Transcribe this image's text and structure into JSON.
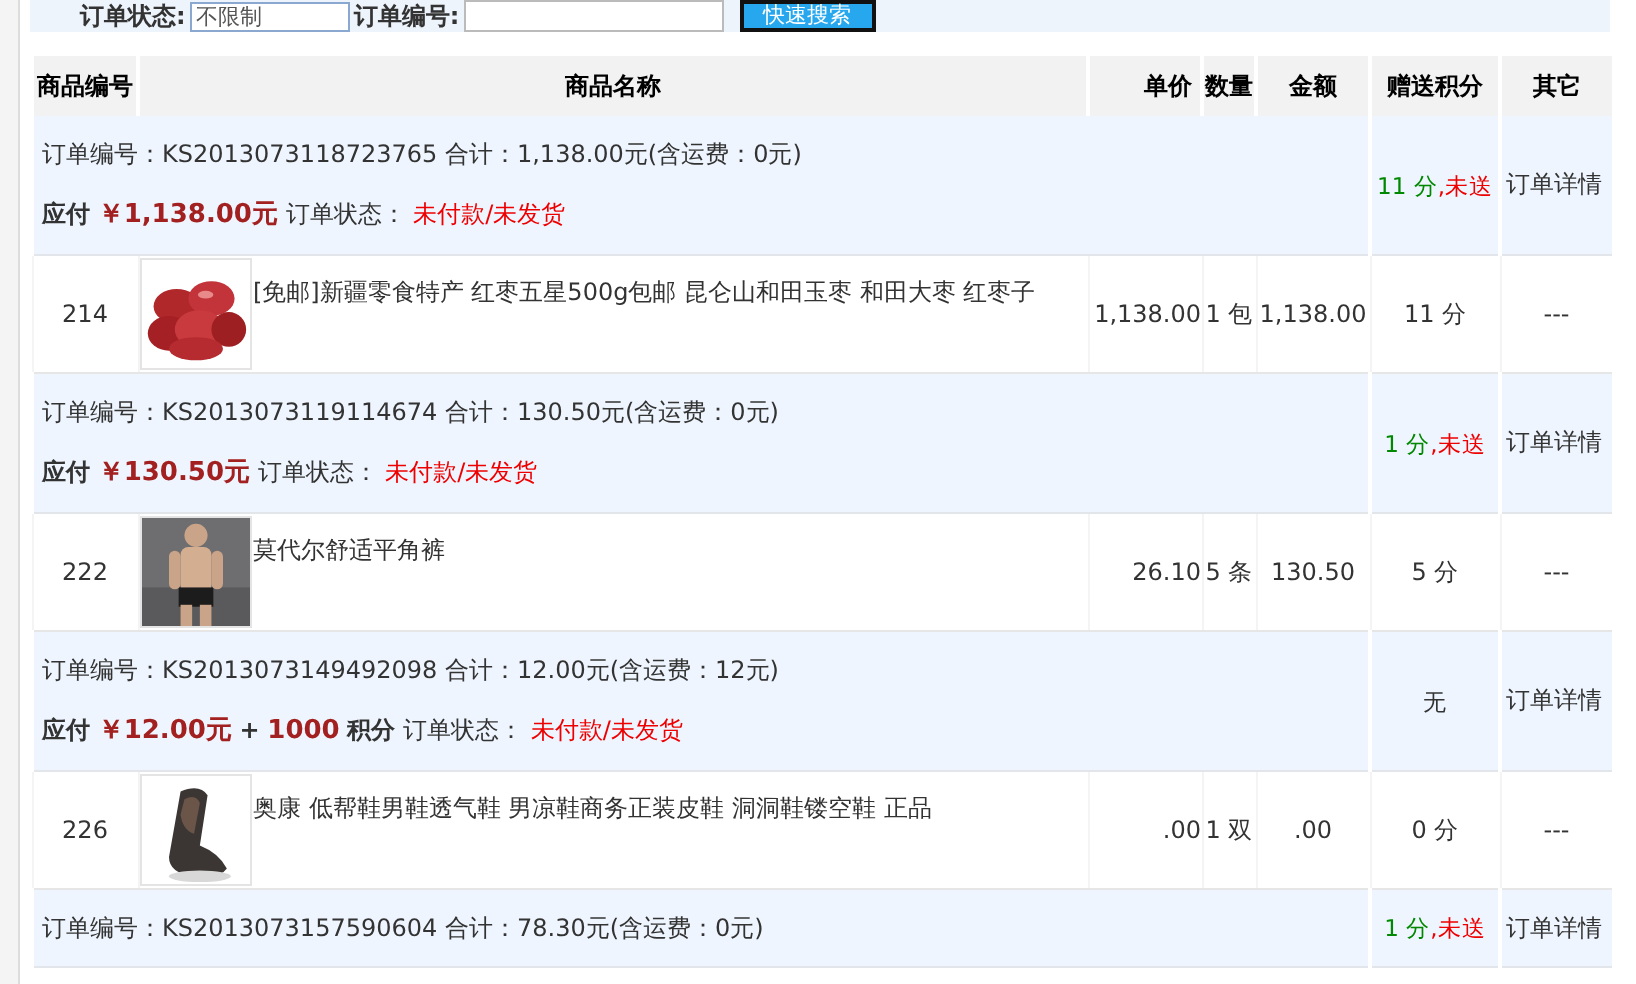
{
  "search": {
    "status_label": "订单状态:",
    "status_value": "不限制",
    "order_label": "订单编号:",
    "button": "快速搜索"
  },
  "columns": [
    "商品编号",
    "商品名称",
    "单价",
    "数量",
    "金额",
    "赠送积分",
    "其它"
  ],
  "orders": [
    {
      "order_no_label": "订单编号：",
      "order_no": "KS2013073118723765",
      "total": "合计：1,138.00元(含运费：0元)",
      "payable_label": "应付",
      "payable": "￥1,138.00元",
      "status_label": "订单状态：",
      "status": "未付款/未发货",
      "points": {
        "kind": "points",
        "value": "11 分",
        "note": ",未送"
      },
      "action": "订单详情",
      "items": [
        {
          "id": "214",
          "name": "[免邮]新疆零食特产 红枣五星500g包邮 昆仑山和田玉枣 和田大枣 红枣子",
          "price": "1,138.00",
          "qty": "1 包",
          "amount": "1,138.00",
          "points": "11 分",
          "other": "---"
        }
      ]
    },
    {
      "order_no_label": "订单编号：",
      "order_no": "KS2013073119114674",
      "total": "合计：130.50元(含运费：0元)",
      "payable_label": "应付",
      "payable": "￥130.50元",
      "status_label": "订单状态：",
      "status": "未付款/未发货",
      "points": {
        "kind": "points",
        "value": "1 分",
        "note": ",未送"
      },
      "action": "订单详情",
      "items": [
        {
          "id": "222",
          "name": "莫代尔舒适平角裤",
          "price": "26.10",
          "qty": "5 条",
          "amount": "130.50",
          "points": "5 分",
          "other": "---"
        }
      ]
    },
    {
      "order_no_label": "订单编号：",
      "order_no": "KS2013073149492098",
      "total": "合计：12.00元(含运费：12元)",
      "payable_label": "应付",
      "payable": "￥12.00元",
      "extra_plus": "+",
      "extra": "1000",
      "extra_unit": "积分",
      "status_label": "订单状态：",
      "status": "未付款/未发货",
      "points": {
        "kind": "none",
        "value": "无"
      },
      "action": "订单详情",
      "items": [
        {
          "id": "226",
          "name": "奥康 低帮鞋男鞋透气鞋 男凉鞋商务正装皮鞋 洞洞鞋镂空鞋 正品",
          "price": ".00",
          "qty": "1 双",
          "amount": ".00",
          "points": "0 分",
          "other": "---"
        }
      ]
    },
    {
      "order_no_label": "订单编号：",
      "order_no": "KS2013073157590604",
      "total": "合计：78.30元(含运费：0元)",
      "points": {
        "kind": "points",
        "value": "1 分",
        "note": ",未送"
      },
      "action": "订单详情"
    }
  ]
}
